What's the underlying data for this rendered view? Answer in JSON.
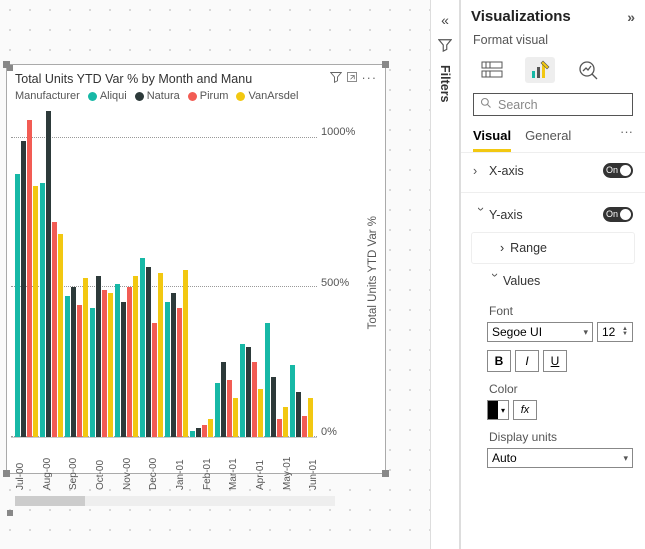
{
  "canvas": {
    "viz_title": "Total Units YTD Var % by Month and Manu",
    "legend_label": "Manufacturer",
    "y_axis_title": "Total Units YTD Var %",
    "y_ticks": [
      "1000%",
      "500%",
      "0%"
    ]
  },
  "chart_data": {
    "type": "bar",
    "title": "Total Units YTD Var % by Month and Manufacturer",
    "ylabel": "Total Units YTD Var %",
    "ylim": [
      0,
      1100
    ],
    "categories": [
      "Jul-00",
      "Aug-00",
      "Sep-00",
      "Oct-00",
      "Nov-00",
      "Dec-00",
      "Jan-01",
      "Feb-01",
      "Mar-01",
      "Apr-01",
      "May-01",
      "Jun-01"
    ],
    "series": [
      {
        "name": "Aliqui",
        "color": "#17b8a6",
        "values": [
          880,
          850,
          470,
          430,
          510,
          600,
          450,
          20,
          180,
          310,
          380,
          240
        ]
      },
      {
        "name": "Natura",
        "color": "#2d3a3a",
        "values": [
          990,
          1090,
          500,
          540,
          450,
          570,
          480,
          30,
          250,
          300,
          200,
          150
        ]
      },
      {
        "name": "Pirum",
        "color": "#f25c54",
        "values": [
          1060,
          720,
          440,
          490,
          500,
          380,
          430,
          40,
          190,
          250,
          60,
          70
        ]
      },
      {
        "name": "VanArsdel",
        "color": "#f2c811",
        "values": [
          840,
          680,
          530,
          480,
          540,
          550,
          560,
          60,
          130,
          160,
          100,
          130
        ]
      }
    ]
  },
  "filters": {
    "label": "Filters"
  },
  "pane": {
    "title": "Visualizations",
    "subtitle": "Format visual",
    "search_placeholder": "Search",
    "tabs": {
      "visual": "Visual",
      "general": "General"
    },
    "xaxis": {
      "label": "X-axis",
      "toggle": "On"
    },
    "yaxis": {
      "label": "Y-axis",
      "toggle": "On",
      "range": "Range",
      "values": "Values",
      "font_label": "Font",
      "font_family": "Segoe UI",
      "font_size": "12",
      "bold": "B",
      "italic": "I",
      "underline": "U",
      "color_label": "Color",
      "fx": "fx",
      "display_units_label": "Display units",
      "display_units": "Auto"
    }
  }
}
